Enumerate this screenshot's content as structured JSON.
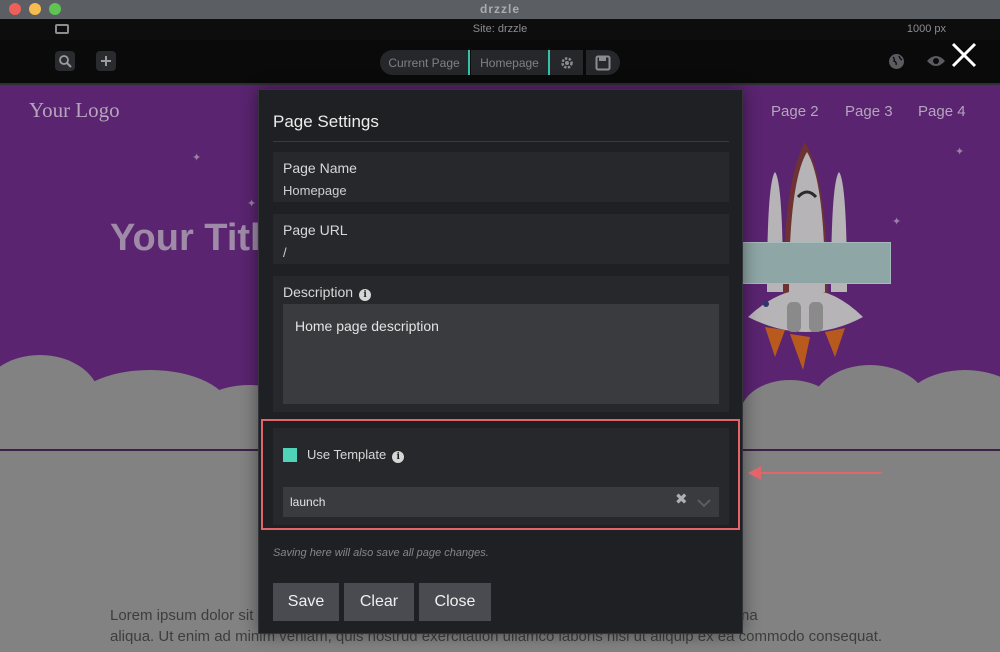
{
  "app": {
    "title": "drzzle"
  },
  "sitebar": {
    "site_label": "Site: drzzle",
    "width_label": "1000 px"
  },
  "toolbar": {
    "current_page_label": "Current Page",
    "homepage_label": "Homepage",
    "icons": [
      "search-page-icon",
      "add-page-icon",
      "gear-icon",
      "save-icon",
      "globe-icon",
      "eye-icon",
      "close-icon"
    ],
    "accent_color": "#34c3a8"
  },
  "preview": {
    "logo": "Your Logo",
    "nav": [
      "Page 2",
      "Page 3",
      "Page 4"
    ],
    "hero_title": "Your Titl",
    "lorem_line1": "Lorem ipsum dolor sit                                                                                    labore et dolore magna",
    "lorem_line2": "aliqua. Ut enim ad minim veniam, quis nostrud exercitation ullamco laboris nisi ut aliquip ex ea commodo consequat."
  },
  "modal": {
    "title": "Page Settings",
    "page_name_label": "Page Name",
    "page_name_value": "Homepage",
    "page_url_label": "Page URL",
    "page_url_value": "/",
    "description_label": "Description",
    "description_value": "Home page description",
    "use_template_label": "Use Template",
    "use_template_checked": true,
    "template_value": "launch",
    "hint": "Saving here will also save all page changes.",
    "buttons": {
      "save": "Save",
      "clear": "Clear",
      "close": "Close"
    }
  },
  "colors": {
    "checkbox": "#4fd3b9",
    "highlight": "#e16569",
    "hero": "#5a2470"
  }
}
